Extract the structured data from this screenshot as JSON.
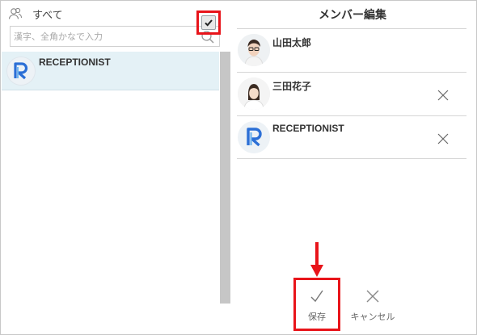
{
  "left_panel": {
    "header_label": "すべて",
    "search": {
      "placeholder": "漢字、全角かなで入力",
      "value": ""
    },
    "candidates": [
      {
        "name": "RECEPTIONIST",
        "checked": true,
        "avatar": "receptionist-logo"
      }
    ]
  },
  "right_panel": {
    "title": "メンバー編集",
    "members": [
      {
        "name": "山田太郎",
        "avatar": "photo-man-glasses",
        "removable": false
      },
      {
        "name": "三田花子",
        "avatar": "photo-woman",
        "removable": true
      },
      {
        "name": "RECEPTIONIST",
        "avatar": "receptionist-logo",
        "removable": true
      }
    ]
  },
  "actions": {
    "save_label": "保存",
    "cancel_label": "キャンセル"
  },
  "colors": {
    "highlight": "#e8141a",
    "selected_row": "#e4f1f6",
    "brand_blue": "#2b6fd6"
  }
}
